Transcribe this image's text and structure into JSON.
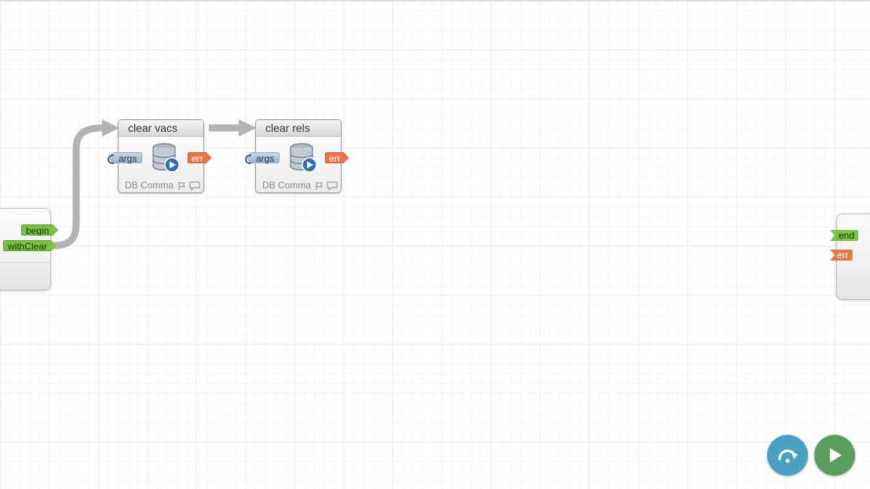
{
  "canvas": {
    "nodes": [
      {
        "title": "clear vacs",
        "type_label": "DB Comma",
        "icon": "database-play-icon",
        "in_port": "args",
        "err_port": "err"
      },
      {
        "title": "clear rels",
        "type_label": "DB Comma",
        "icon": "database-play-icon",
        "in_port": "args",
        "err_port": "err"
      }
    ],
    "start_panel": {
      "ports": [
        "begin",
        "withClear"
      ]
    },
    "end_panel": {
      "ports": [
        "end",
        "err"
      ]
    }
  },
  "controls": {
    "step_button_icon": "step-over-icon",
    "run_button_icon": "play-icon",
    "step_color": "#4aa0c0",
    "run_color": "#5a9e5e"
  },
  "colors": {
    "port_green": "#7cc242",
    "port_error": "#e8764b",
    "port_input": "#a9bfd4",
    "wire": "#b3b3b3"
  }
}
